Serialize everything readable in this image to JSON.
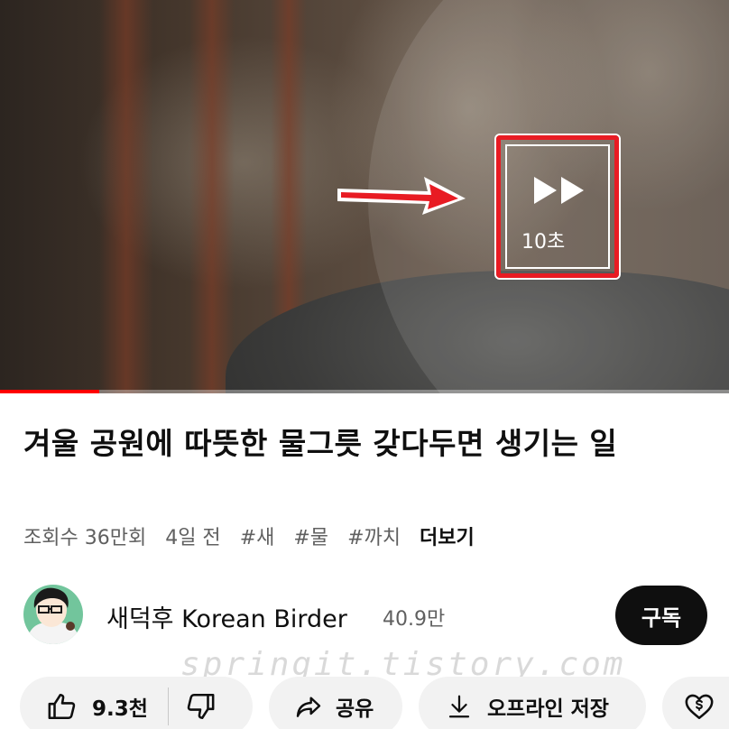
{
  "player": {
    "skip_label": "10초",
    "progress_fraction": 0.136
  },
  "video": {
    "title": "겨울 공원에 따뜻한 물그릇 갖다두면 생기는 일",
    "views": "조회수 36만회",
    "age": "4일 전",
    "hashtags": [
      "#새",
      "#물",
      "#까치"
    ],
    "more_label": "더보기"
  },
  "channel": {
    "name": "새덕후 Korean Birder",
    "subscribers": "40.9만",
    "subscribe_label": "구독"
  },
  "actions": {
    "like_count": "9.3천",
    "share_label": "공유",
    "download_label": "오프라인 저장"
  },
  "watermark": "springit.tistory.com",
  "colors": {
    "annotation_red": "#e81b23",
    "progress_red": "#ff0000",
    "subscribe_bg": "#0f0f0f",
    "chip_bg": "#f2f2f2"
  },
  "icons": {
    "skip": "fast-forward-icon",
    "like": "thumbs-up-icon",
    "dislike": "thumbs-down-icon",
    "share": "share-arrow-icon",
    "download": "download-icon",
    "thanks": "heart-dollar-icon"
  }
}
